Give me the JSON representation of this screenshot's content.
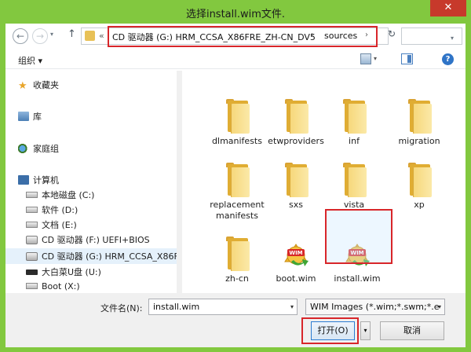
{
  "window": {
    "title": "选择install.wim文件.",
    "close_glyph": "✕"
  },
  "nav": {
    "back_glyph": "←",
    "forward_glyph": "→",
    "dropdown_glyph": "▾",
    "up_glyph": "↑",
    "address_chevrons": "«",
    "address_segments": [
      "CD 驱动器 (G:) HRM_CCSA_X86FRE_ZH-CN_DV5",
      "sources"
    ],
    "address_separator": "›",
    "refresh_glyph": "↻"
  },
  "toolbar": {
    "organize_label": "组织 ▾",
    "help_glyph": "?"
  },
  "navpane": {
    "favorites": "收藏夹",
    "libraries": "库",
    "homegroup": "家庭组",
    "computer": "计算机",
    "drives": [
      "本地磁盘 (C:)",
      "软件 (D:)",
      "文档 (E:)",
      "CD 驱动器 (F:) UEFI+BIOS",
      "CD 驱动器 (G:) HRM_CCSA_X86FR",
      "大白菜U盘 (U:)",
      "Boot (X:)"
    ]
  },
  "files": [
    {
      "name": "dlmanifests",
      "type": "folder"
    },
    {
      "name": "etwproviders",
      "type": "folder"
    },
    {
      "name": "inf",
      "type": "folder"
    },
    {
      "name": "migration",
      "type": "folder"
    },
    {
      "name": "replacementmanifests",
      "type": "folder"
    },
    {
      "name": "sxs",
      "type": "folder"
    },
    {
      "name": "vista",
      "type": "folder"
    },
    {
      "name": "xp",
      "type": "folder"
    },
    {
      "name": "zh-cn",
      "type": "folder"
    },
    {
      "name": "boot.wim",
      "type": "wim"
    },
    {
      "name": "install.wim",
      "type": "wim"
    }
  ],
  "wim_icon_label": "WIM",
  "bottom": {
    "filename_label": "文件名(N):",
    "filename_value": "install.wim",
    "filetype_value": "WIM Images (*.wim;*.swm;*.e",
    "dropdown_glyph": "▾",
    "open_label": "打开(O)",
    "split_glyph": "▾",
    "cancel_label": "取消"
  },
  "colors": {
    "highlight": "#d8262a",
    "window_border": "#82c83f",
    "folder": "#f6d77a"
  }
}
